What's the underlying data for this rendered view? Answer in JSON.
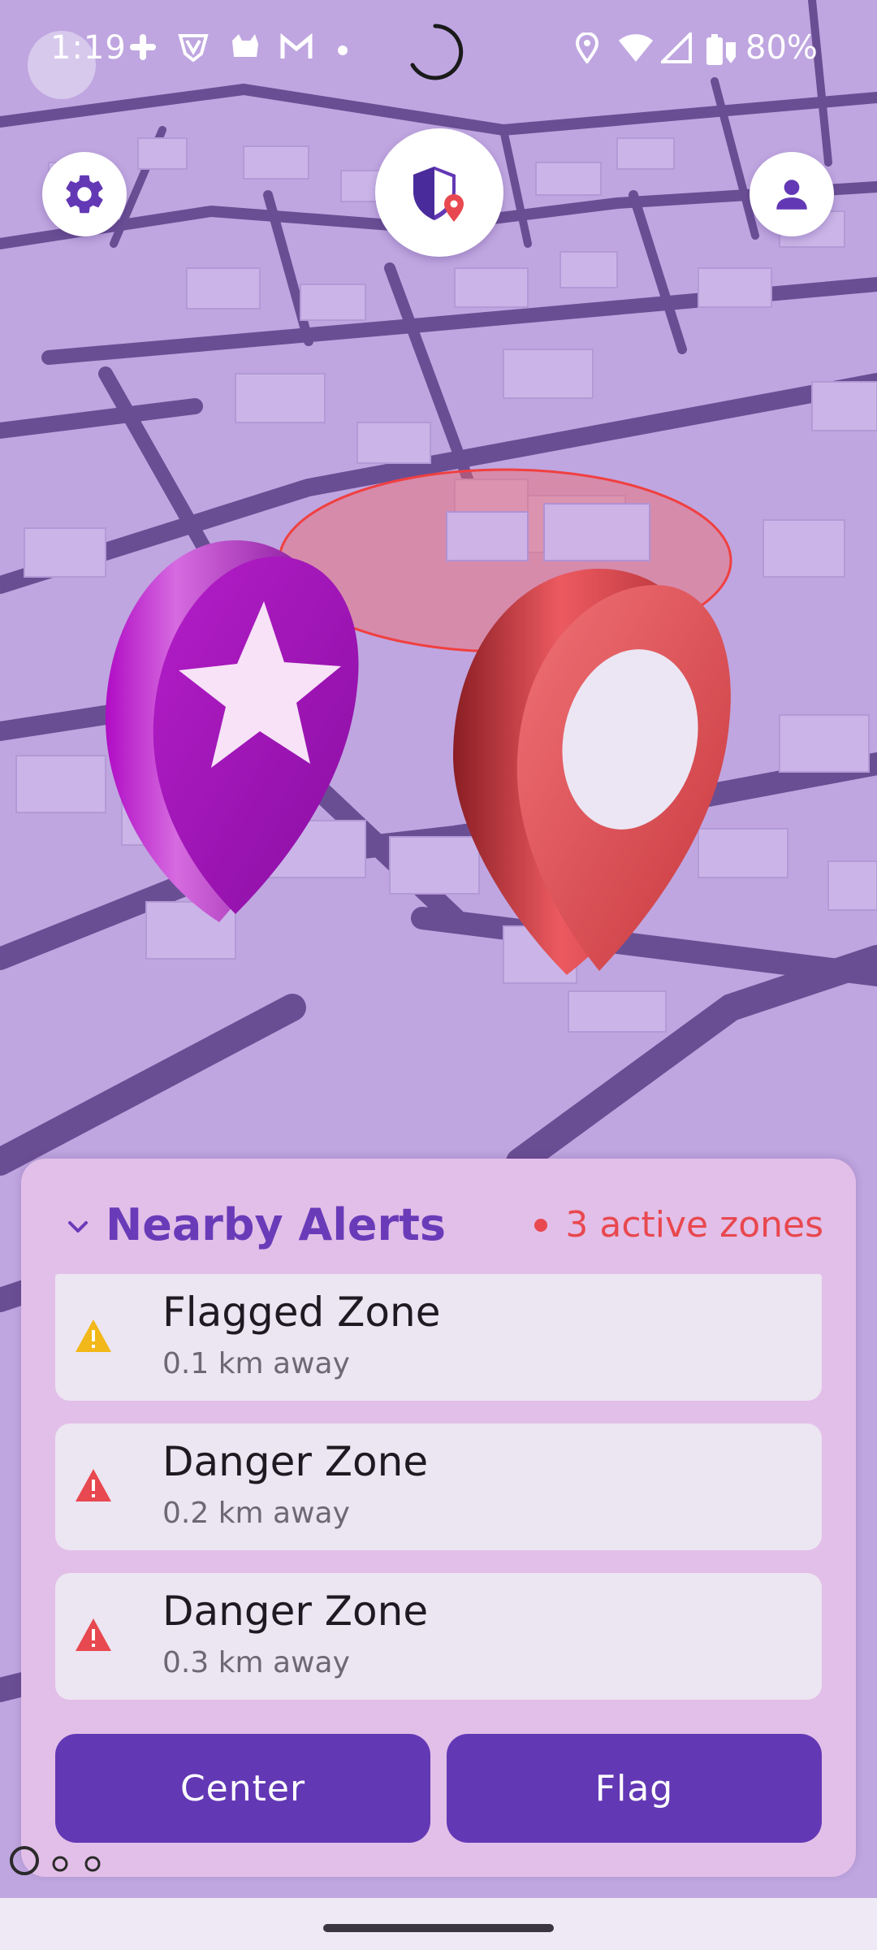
{
  "status_bar": {
    "time": "1:19",
    "battery": "80%",
    "icons": [
      "slack-icon",
      "shield-v-icon",
      "cat-icon",
      "gmail-icon",
      "dot-icon",
      "location-icon",
      "wifi-icon",
      "signal-icon",
      "battery-icon"
    ]
  },
  "top_bar": {
    "settings_icon": "gear-icon",
    "logo_icon": "shield-location-icon",
    "profile_icon": "person-icon"
  },
  "map": {
    "markers": [
      "star-pin-icon",
      "location-pin-icon"
    ],
    "zone_color": "#f26b6b"
  },
  "panel": {
    "title": "Nearby Alerts",
    "active_zones": "3 active zones",
    "alerts": [
      {
        "title": "Flagged Zone",
        "distance": "0.1 km away",
        "icon": "warning-yellow-icon",
        "color": "#f2b718"
      },
      {
        "title": "Danger Zone",
        "distance": "0.2 km away",
        "icon": "warning-red-icon",
        "color": "#e8484f"
      },
      {
        "title": "Danger Zone",
        "distance": "0.3 km away",
        "icon": "warning-red-icon",
        "color": "#e8484f"
      }
    ],
    "buttons": {
      "center": "Center",
      "flag": "Flag"
    }
  },
  "colors": {
    "accent": "#6338b5",
    "title": "#6a3bb8",
    "alert_red": "#e8484f",
    "panel_bg": "#e2bfe8",
    "map_bg": "#bfa6e0"
  }
}
